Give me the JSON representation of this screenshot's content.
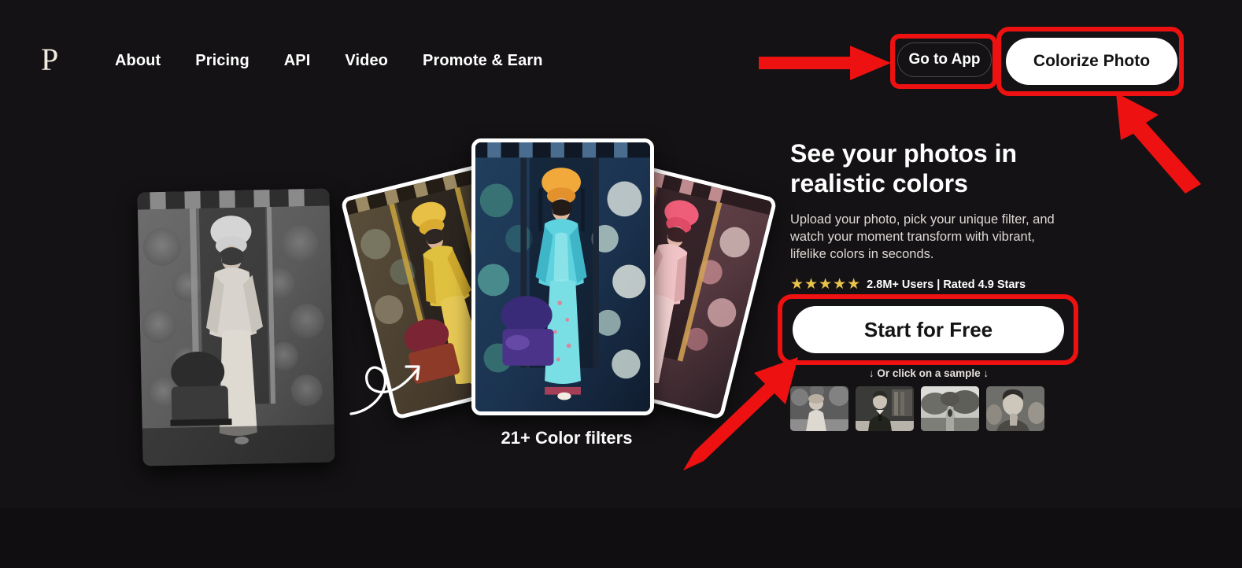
{
  "brand": {
    "logo_text": "P"
  },
  "nav": {
    "items": [
      {
        "label": "About"
      },
      {
        "label": "Pricing"
      },
      {
        "label": "API"
      },
      {
        "label": "Video"
      },
      {
        "label": "Promote & Earn"
      }
    ],
    "goto_app_label": "Go to App",
    "colorize_label": "Colorize Photo"
  },
  "hero": {
    "title": "See your photos in realistic colors",
    "subtitle": "Upload your photo, pick your unique filter, and watch your moment transform with vibrant, lifelike colors in seconds.",
    "stars": "★★★★★",
    "rating_text": "2.8M+ Users | Rated 4.9 Stars",
    "cta_label": "Start for Free",
    "sample_hint": "↓ Or click on a sample ↓"
  },
  "showcase": {
    "filters_label": "21+ Color filters",
    "before_photo_alt": "vintage black and white portrait of woman in qipao",
    "cards": [
      {
        "name": "yellow-filter-card",
        "tint": "#c9a227"
      },
      {
        "name": "cyan-filter-card",
        "tint": "#46c8d8"
      },
      {
        "name": "pink-filter-card",
        "tint": "#e05a7a"
      }
    ]
  },
  "samples": [
    {
      "name": "sample-woman-garden"
    },
    {
      "name": "sample-man-desk"
    },
    {
      "name": "sample-village-path"
    },
    {
      "name": "sample-migrant-mother"
    }
  ],
  "annotations": {
    "accent_color": "#ee1111",
    "boxes": [
      {
        "name": "highlight-go-to-app"
      },
      {
        "name": "highlight-colorize-photo"
      },
      {
        "name": "highlight-start-for-free"
      }
    ],
    "arrows": [
      {
        "name": "arrow-to-go-to-app",
        "direction": "right"
      },
      {
        "name": "arrow-to-colorize-photo",
        "direction": "up-left"
      },
      {
        "name": "arrow-to-start-for-free",
        "direction": "up-right"
      }
    ]
  },
  "colors": {
    "background": "#141214",
    "accent_red": "#ee1111",
    "star_gold": "#e9c34a",
    "button_white": "#ffffff"
  }
}
